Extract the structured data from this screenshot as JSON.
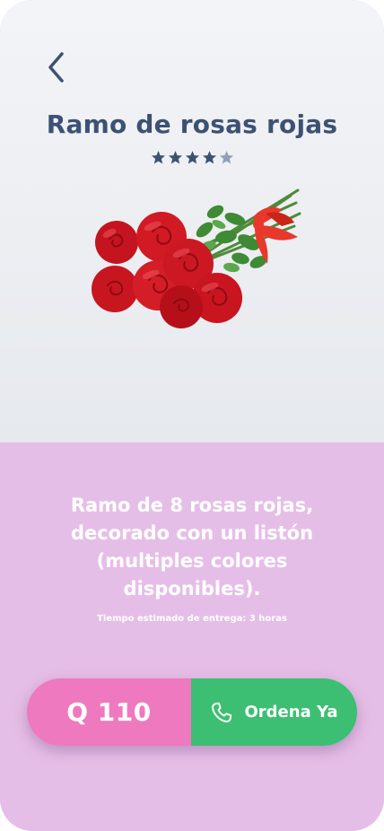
{
  "product": {
    "title": "Ramo de rosas rojas",
    "rating": 4,
    "rating_max": 5,
    "description": "Ramo de 8 rosas rojas, decorado con un listón (multiples colores disponibles).",
    "delivery": "Tiempo estimado de entrega: 3 horas"
  },
  "cta": {
    "price": "Q 110",
    "order_label": "Ordena Ya"
  },
  "icons": {
    "back": "chevron-left-icon",
    "star": "star-icon",
    "phone": "phone-icon"
  },
  "colors": {
    "title": "#3d5273",
    "star_filled": "#3d5273",
    "star_empty": "#8fa0b8",
    "bottom_bg": "#e5bee7",
    "price_bg": "#ee79bf",
    "order_bg": "#3cbf72"
  }
}
